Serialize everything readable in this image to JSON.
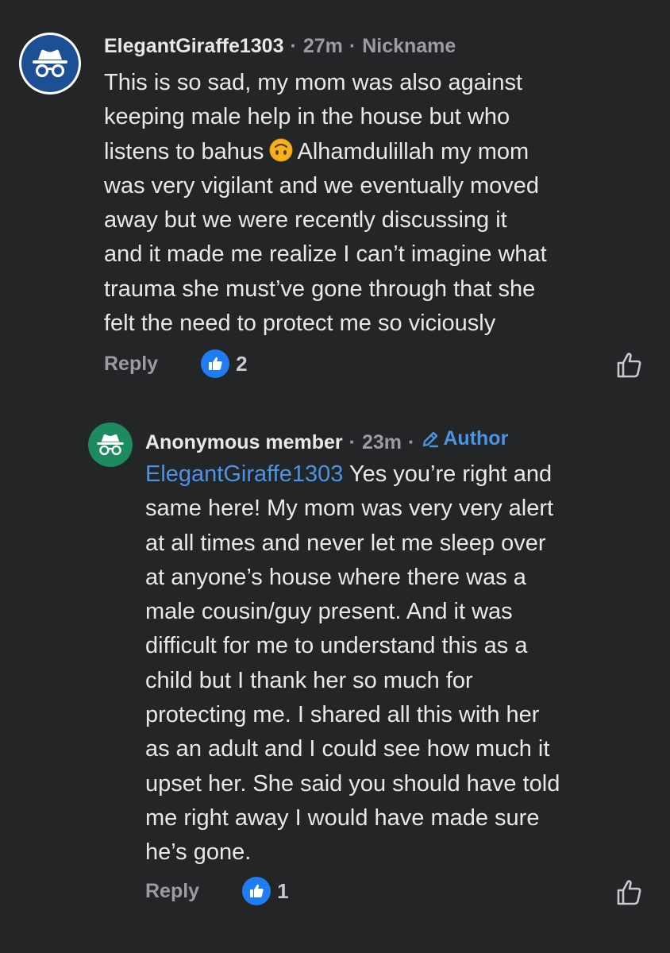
{
  "comments": [
    {
      "author": "ElegantGiraffe1303",
      "separator": "·",
      "time": "27m",
      "tag": "Nickname",
      "avatar_icon": "incognito-icon",
      "avatar_color": "#1d4f95",
      "body_lines": [
        "This is so sad, my mom was also against",
        "keeping male help in the house but who",
        "listens to bahus",
        "Alhamdulillah my mom",
        "was very vigilant and we eventually moved",
        "away but we were recently discussing it",
        "and it made me realize I can’t imagine what",
        "trauma she must’ve gone through that she",
        "felt the need to protect me so viciously"
      ],
      "emoji": "upside-down-face-emoji",
      "reply_label": "Reply",
      "reaction_count": "2"
    }
  ],
  "reply": {
    "author": "Anonymous member",
    "separator": "·",
    "time": "23m",
    "tag": "Author",
    "avatar_icon": "incognito-icon",
    "avatar_color": "#1e8a5f",
    "mention": "ElegantGiraffe1303",
    "body_first_line_rest": " Yes you’re right and",
    "body_lines": [
      "same here! My mom was very very alert",
      "at all times and never let me sleep over",
      "at anyone’s house where there was a",
      "male cousin/guy present. And it was",
      "difficult for me to understand this as a",
      "child but I thank her so much for",
      "protecting me. I shared all this with her",
      "as an adult and I could see how much it",
      "upset her. She said you should have told",
      "me right away I would have made sure",
      "he’s gone."
    ],
    "reply_label": "Reply",
    "reaction_count": "1"
  },
  "colors": {
    "background": "#242526",
    "text": "#e8e8ea",
    "muted": "#9a9ca1",
    "link": "#4b93e6",
    "like_badge": "#1f7cf2"
  }
}
